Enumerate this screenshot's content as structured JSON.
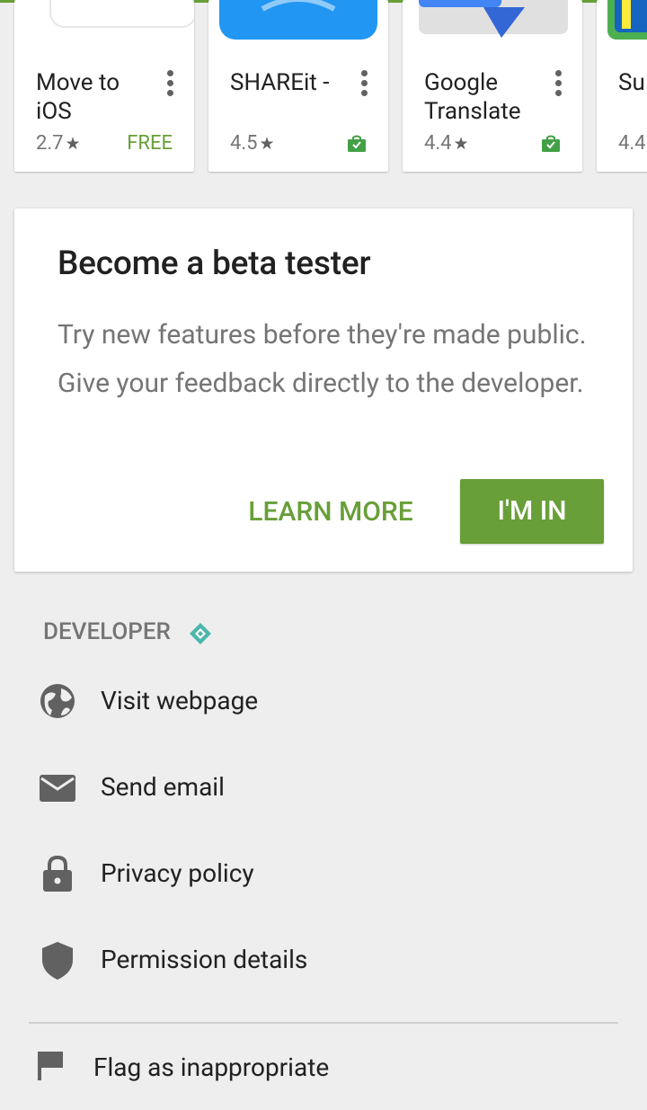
{
  "apps": [
    {
      "name": "Move to iOS",
      "rating": "2.7",
      "price": "FREE"
    },
    {
      "name": "SHAREit -",
      "rating": "4.5"
    },
    {
      "name": "Google Translate",
      "rating": "4.4"
    },
    {
      "name": "Su Su",
      "rating": "4.4"
    }
  ],
  "beta": {
    "title": "Become a beta tester",
    "description": "Try new features before they're made public. Give your feedback directly to the developer.",
    "learn_more": "LEARN MORE",
    "im_in": "I'M IN"
  },
  "developer": {
    "heading": "DEVELOPER",
    "items": [
      {
        "label": "Visit webpage",
        "icon": "globe-icon"
      },
      {
        "label": "Send email",
        "icon": "email-icon"
      },
      {
        "label": "Privacy policy",
        "icon": "lock-icon"
      },
      {
        "label": "Permission details",
        "icon": "shield-icon"
      }
    ]
  },
  "flag": {
    "label": "Flag as inappropriate",
    "icon": "flag-icon"
  },
  "colors": {
    "accent": "#689f38",
    "background": "#eeeeee"
  }
}
